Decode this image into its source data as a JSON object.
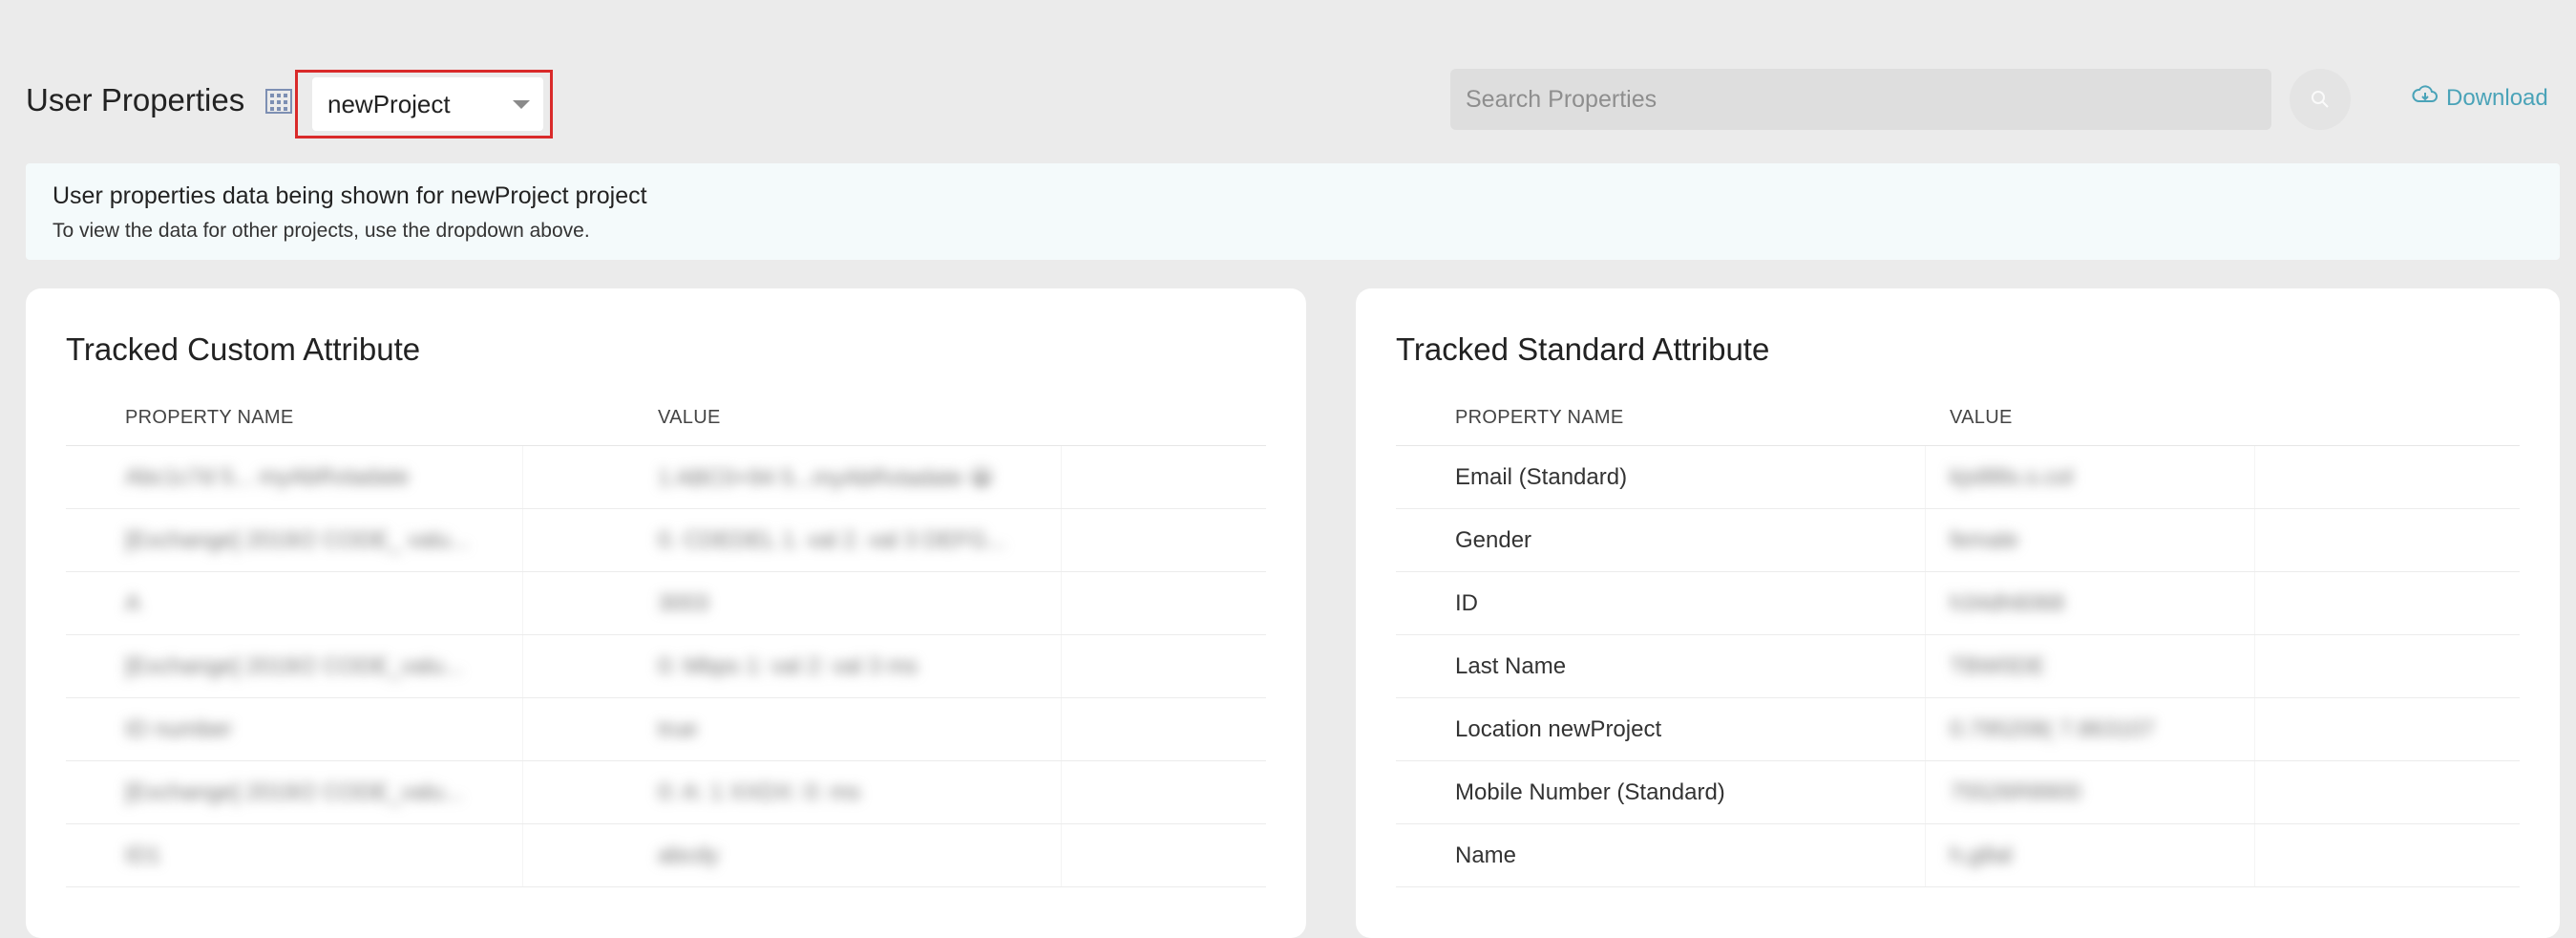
{
  "header": {
    "title": "User Properties",
    "project_selector": {
      "selected": "newProject"
    },
    "search": {
      "placeholder": "Search Properties"
    },
    "download_label": "Download"
  },
  "banner": {
    "title": "User properties data being shown for newProject project",
    "subtitle": "To view the data for other projects, use the dropdown above."
  },
  "custom_panel": {
    "title": "Tracked Custom Attribute",
    "columns": [
      "PROPERTY NAME",
      "VALUE"
    ],
    "rows": [
      {
        "name": "  Abc1c7d 5... myAbRvtadate",
        "value": "1 ABC0+94 5...myAbRvtadate 😀"
      },
      {
        "name": "[Exchange] 2019/2 CODE_ valu...",
        "value": "0. CDEDEL 1. val 2. val 3 DEFG..."
      },
      {
        "name": "A",
        "value": "3003"
      },
      {
        "name": "[Exchange] 2019/2 CODE_valu...",
        "value": "0: Mbps 1: val 2: val 3 ms"
      },
      {
        "name": "ID number",
        "value": "true"
      },
      {
        "name": "[Exchange] 2019/2 CODE_valu...",
        "value": "0: A: 1 XXDX: 0: ms"
      },
      {
        "name": "ID1",
        "value": "abcdy"
      }
    ]
  },
  "standard_panel": {
    "title": "Tracked Standard Attribute",
    "columns": [
      "PROPERTY NAME",
      "VALUE"
    ],
    "rows": [
      {
        "name": "Email (Standard)",
        "value": "kjs8l8s.s.col"
      },
      {
        "name": "Gender",
        "value": "female"
      },
      {
        "name": "ID",
        "value": "h34dh6068"
      },
      {
        "name": "Last Name",
        "value": "TBW0DE"
      },
      {
        "name": "Location newProject",
        "value": "0.795208( 7.863107"
      },
      {
        "name": "Mobile Number (Standard)",
        "value": "75526R8900"
      },
      {
        "name": "Name",
        "value": "h,g8al"
      }
    ]
  },
  "colors": {
    "background": "#ebebeb",
    "accent": "#4aa3b8",
    "highlight": "#d92a2a",
    "banner": "#f4fafb"
  }
}
